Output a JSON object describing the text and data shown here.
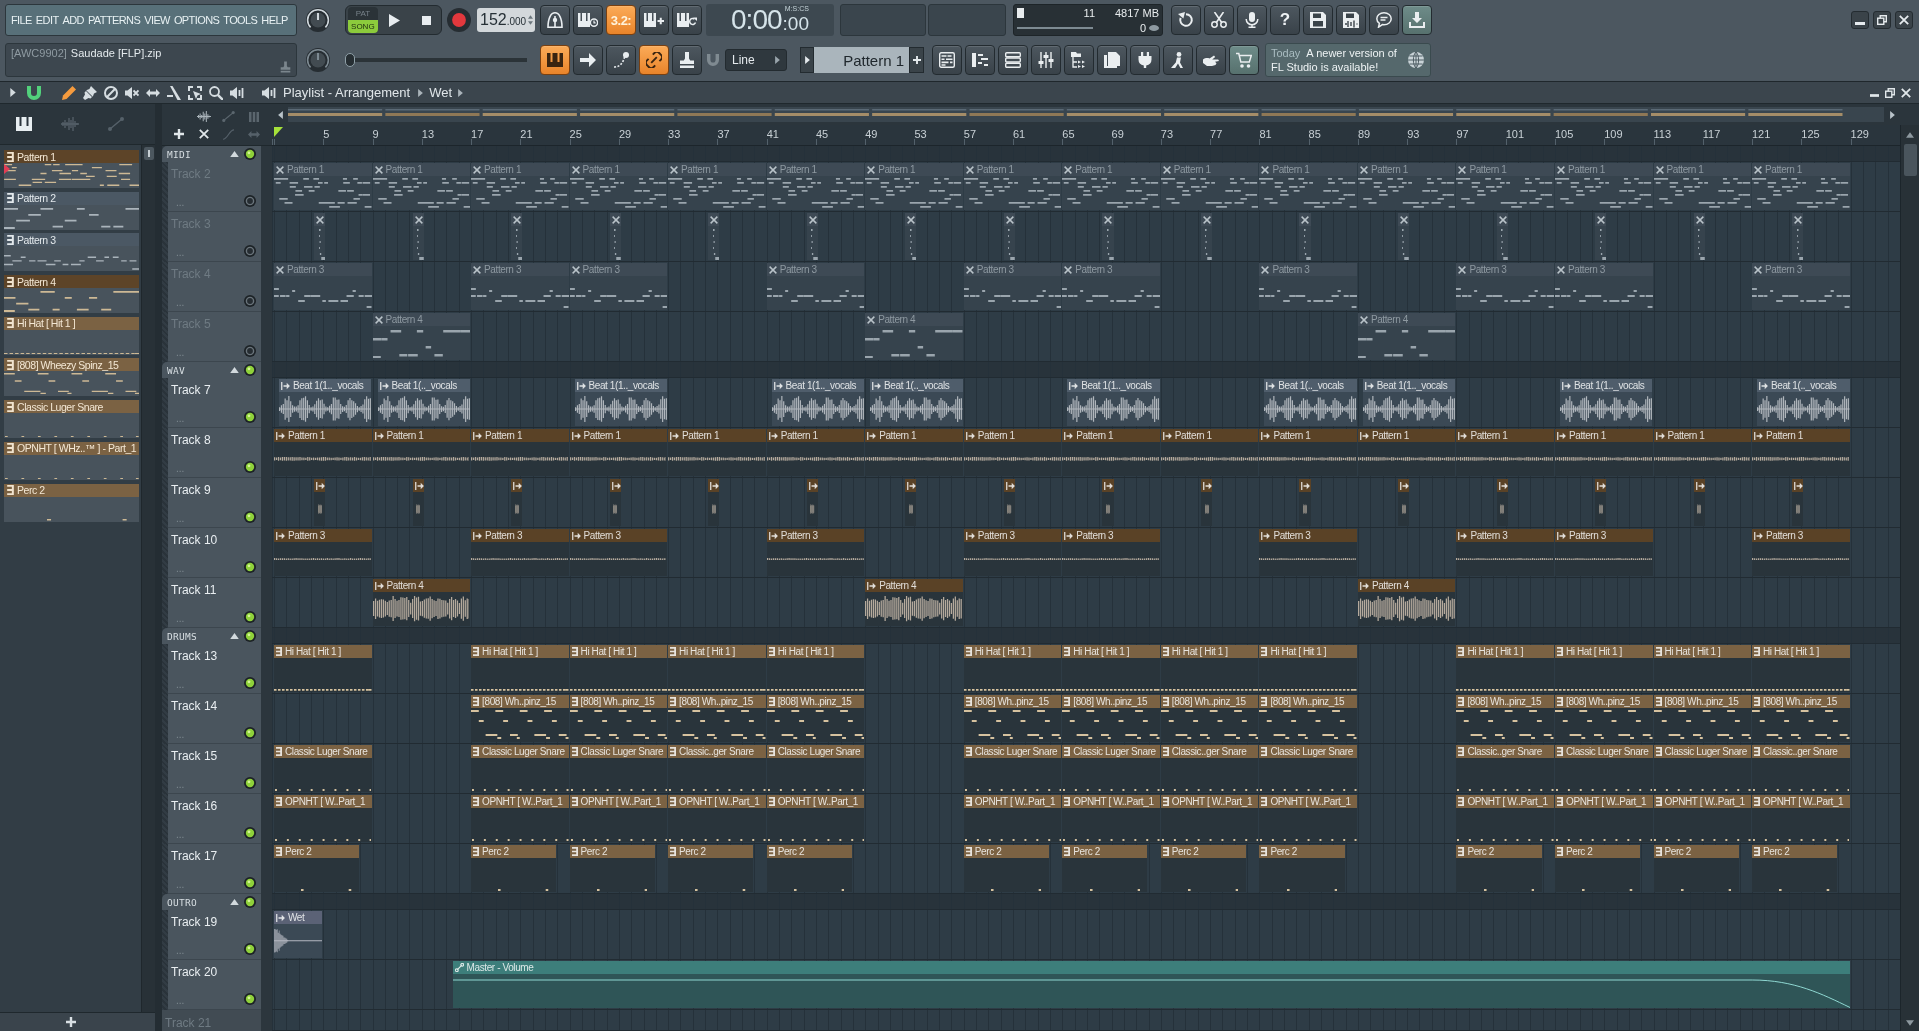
{
  "toolbar": {
    "menu": [
      "FILE",
      "EDIT",
      "ADD",
      "PATTERNS",
      "VIEW",
      "OPTIONS",
      "TOOLS",
      "HELP"
    ],
    "transport": {
      "modes": [
        {
          "label": "PAT",
          "selected": false
        },
        {
          "label": "SONG",
          "selected": true
        }
      ],
      "tempo": "152",
      "tempo_decimals": ".000"
    },
    "record_buttons": [
      {
        "on": false
      },
      {
        "on": false
      },
      {
        "label": "3.2:",
        "on": true
      },
      {
        "on": false
      },
      {
        "on": false
      }
    ],
    "time": {
      "value": "0:00",
      "fraction": ":00",
      "unit": "M:S:CS"
    },
    "monitor": {
      "cpu": "11",
      "memory": "4817 MB",
      "voices": "0"
    },
    "shortcut_buttons": [
      {
        "highlighted": false
      },
      {
        "highlighted": false
      },
      {
        "highlighted": false
      },
      {
        "label": "?",
        "highlighted": false
      },
      {
        "highlighted": false
      },
      {
        "highlighted": false
      },
      {
        "highlighted": false
      },
      {
        "highlighted": true
      }
    ],
    "hint": {
      "tag": "[AWC9902]",
      "text": "Saudade [FLP].zip"
    },
    "pitch_slider": {
      "level": 0
    },
    "snap_buttons": [
      {
        "on": true
      },
      {
        "on": false
      },
      {
        "on": false
      },
      {
        "on": true
      },
      {
        "on": false
      }
    ],
    "snap": {
      "value": "Line"
    },
    "pattern_selector": {
      "value": "Pattern 1"
    },
    "view_buttons": [
      {
        "highlighted": false
      },
      {
        "highlighted": false
      },
      {
        "highlighted": false
      },
      {
        "highlighted": false
      },
      {
        "highlighted": false
      },
      {
        "highlighted": false
      },
      {
        "highlighted": false
      },
      {
        "highlighted": false
      },
      {
        "highlighted": false
      },
      {
        "highlighted": true
      }
    ],
    "news": {
      "when": "Today",
      "text": "A newer version of FL Studio is available!"
    }
  },
  "playlist": {
    "title": "Playlist - Arrangement",
    "crumb": "Wet",
    "snap_on": true,
    "tools": [
      {
        "selected": true
      },
      {
        "selected": false
      },
      {
        "selected": false
      },
      {
        "selected": false
      },
      {
        "selected": false
      },
      {
        "selected": false
      },
      {
        "selected": false
      },
      {
        "selected": false
      },
      {
        "selected": false
      }
    ],
    "picker": {
      "tabs": [
        {
          "selected": true
        },
        {
          "selected": false
        },
        {
          "selected": false
        }
      ],
      "patterns": [
        {
          "label": "Pattern 1",
          "color": "#5d4428",
          "selected": true
        },
        {
          "label": "Pattern 2",
          "color": "#4b5864",
          "selected": false
        },
        {
          "label": "Pattern 3",
          "color": "#4b5864",
          "selected": false
        },
        {
          "label": "Pattern 4",
          "color": "#5d4428",
          "selected": false
        },
        {
          "label": "Hi Hat [ Hit 1 ]",
          "color": "#7b6243",
          "selected": false
        },
        {
          "label": "[808] Wheezy Spinz_15",
          "color": "#7b6243",
          "selected": false
        },
        {
          "label": "Classic Luger Snare",
          "color": "#7b6243",
          "selected": false
        },
        {
          "label": "OPNHT [ WHz..™ ] - Part_1",
          "color": "#7b6243",
          "selected": false
        },
        {
          "label": "Perc 2",
          "color": "#7b6243",
          "selected": false
        }
      ]
    },
    "ruler": [
      "5",
      "9",
      "13",
      "17",
      "21",
      "25",
      "29",
      "33",
      "37",
      "41",
      "45",
      "49",
      "53",
      "57",
      "61",
      "65",
      "69",
      "73",
      "77",
      "81",
      "85",
      "89",
      "93",
      "97",
      "101",
      "105",
      "109",
      "113",
      "117",
      "121",
      "125",
      "129"
    ],
    "groups": [
      {
        "name": "MIDI",
        "expanded": true,
        "on": true,
        "tracks": [
          {
            "name": "Track 2",
            "more": "...",
            "on": false,
            "color": "#3e4a55",
            "kind": "pattern",
            "clips": [
              {
                "label": "Pattern 1",
                "muted": true
              },
              {
                "label": "Pattern 1",
                "muted": true
              },
              {
                "label": "Pattern 1",
                "muted": true
              },
              {
                "label": "Pattern 1",
                "muted": true
              },
              {
                "label": "Pattern 1",
                "muted": true
              },
              {
                "label": "Pattern 1",
                "muted": true
              },
              {
                "label": "Pattern 1",
                "muted": true
              },
              {
                "label": "Pattern 1",
                "muted": true
              },
              {
                "label": "Pattern 1",
                "muted": true
              },
              {
                "label": "Pattern 1",
                "muted": true
              },
              {
                "label": "Pattern 1",
                "muted": true
              },
              {
                "label": "Pattern 1",
                "muted": true
              },
              {
                "label": "Pattern 1",
                "muted": true
              },
              {
                "label": "Pattern 1",
                "muted": true
              },
              {
                "label": "Pattern 1",
                "muted": true
              },
              {
                "label": "Pattern 1",
                "muted": true
              }
            ]
          },
          {
            "name": "Track 3",
            "more": "...",
            "on": false,
            "color": "#3e4a55",
            "kind": "pattern",
            "clips": [
              {
                "muted": true
              },
              {
                "muted": true
              },
              {
                "muted": true
              },
              {
                "muted": true
              },
              {
                "muted": true
              },
              {
                "muted": true
              },
              {
                "muted": true
              },
              {
                "muted": true
              },
              {
                "muted": true
              },
              {
                "muted": true
              },
              {
                "muted": true
              },
              {
                "muted": true
              },
              {
                "muted": true
              },
              {
                "muted": true
              },
              {
                "muted": true
              },
              {
                "muted": true
              }
            ]
          },
          {
            "name": "Track 4",
            "more": "...",
            "on": false,
            "color": "#3e4a55",
            "kind": "pattern",
            "clips": [
              {
                "label": "Pattern 3",
                "muted": true
              },
              {
                "label": "Pattern 3",
                "muted": true
              },
              {
                "label": "Pattern 3",
                "muted": true
              },
              {
                "label": "Pattern 3",
                "muted": true
              },
              {
                "label": "Pattern 3",
                "muted": true
              },
              {
                "label": "Pattern 3",
                "muted": true
              },
              {
                "label": "Pattern 3",
                "muted": true
              },
              {
                "label": "Pattern 3",
                "muted": true
              },
              {
                "label": "Pattern 3",
                "muted": true
              },
              {
                "label": "Pattern 3",
                "muted": true
              }
            ]
          },
          {
            "name": "Track 5",
            "more": "...",
            "on": false,
            "color": "#3e4a55",
            "kind": "pattern",
            "clips": [
              {
                "label": "Pattern 4",
                "muted": true
              },
              {
                "label": "Pattern 4",
                "muted": true
              },
              {
                "label": "Pattern 4",
                "muted": true
              }
            ]
          }
        ]
      },
      {
        "name": "WAV",
        "expanded": true,
        "on": true,
        "tracks": [
          {
            "name": "Track 7",
            "more": "...",
            "on": true,
            "color": "#4f5d6b",
            "kind": "audio",
            "clips": [
              {
                "label": "Beat 1(1.._vocals",
                "muted": false
              },
              {
                "label": "Beat 1(.._vocals",
                "muted": false
              },
              {
                "label": "Beat 1(1.._vocals",
                "muted": false
              },
              {
                "label": "Beat 1(1.._vocals",
                "muted": false
              },
              {
                "label": "Beat 1(.._vocals",
                "muted": false
              },
              {
                "label": "Beat 1(1.._vocals",
                "muted": false
              },
              {
                "label": "Beat 1(.._vocals",
                "muted": false
              },
              {
                "label": "Beat 1(1.._vocals",
                "muted": false
              },
              {
                "label": "Beat 1(1.._vocals",
                "muted": false
              },
              {
                "label": "Beat 1(.._vocals",
                "muted": false
              }
            ]
          },
          {
            "name": "Track 8",
            "more": "...",
            "on": true,
            "color": "#5a4226",
            "kind": "audio",
            "clips": [
              {
                "label": "Pattern 1",
                "muted": false
              },
              {
                "label": "Pattern 1",
                "muted": false
              },
              {
                "label": "Pattern 1",
                "muted": false
              },
              {
                "label": "Pattern 1",
                "muted": false
              },
              {
                "label": "Pattern 1",
                "muted": false
              },
              {
                "label": "Pattern 1",
                "muted": false
              },
              {
                "label": "Pattern 1",
                "muted": false
              },
              {
                "label": "Pattern 1",
                "muted": false
              },
              {
                "label": "Pattern 1",
                "muted": false
              },
              {
                "label": "Pattern 1",
                "muted": false
              },
              {
                "label": "Pattern 1",
                "muted": false
              },
              {
                "label": "Pattern 1",
                "muted": false
              },
              {
                "label": "Pattern 1",
                "muted": false
              },
              {
                "label": "Pattern 1",
                "muted": false
              },
              {
                "label": "Pattern 1",
                "muted": false
              },
              {
                "label": "Pattern 1",
                "muted": false
              }
            ]
          },
          {
            "name": "Track 9",
            "more": "...",
            "on": true,
            "color": "#5a4226",
            "kind": "audio",
            "clips": [
              {
                "muted": false
              },
              {
                "muted": false
              },
              {
                "muted": false
              },
              {
                "muted": false
              },
              {
                "muted": false
              },
              {
                "muted": false
              },
              {
                "muted": false
              },
              {
                "muted": false
              },
              {
                "muted": false
              },
              {
                "muted": false
              },
              {
                "muted": false
              },
              {
                "muted": false
              },
              {
                "muted": false
              },
              {
                "muted": false
              },
              {
                "muted": false
              },
              {
                "muted": false
              }
            ]
          },
          {
            "name": "Track 10",
            "more": "...",
            "on": true,
            "color": "#5a4226",
            "kind": "audio",
            "clips": [
              {
                "label": "Pattern 3",
                "muted": false
              },
              {
                "label": "Pattern 3",
                "muted": false
              },
              {
                "label": "Pattern 3",
                "muted": false
              },
              {
                "label": "Pattern 3",
                "muted": false
              },
              {
                "label": "Pattern 3",
                "muted": false
              },
              {
                "label": "Pattern 3",
                "muted": false
              },
              {
                "label": "Pattern 3",
                "muted": false
              },
              {
                "label": "Pattern 3",
                "muted": false
              },
              {
                "label": "Pattern 3",
                "muted": false
              },
              {
                "label": "Pattern 3",
                "muted": false
              }
            ]
          },
          {
            "name": "Track 11",
            "more": "...",
            "on": true,
            "color": "#5a4226",
            "kind": "audio",
            "clips": [
              {
                "label": "Pattern 4",
                "muted": false
              },
              {
                "label": "Pattern 4",
                "muted": false
              },
              {
                "label": "Pattern 4",
                "muted": false
              }
            ]
          }
        ]
      },
      {
        "name": "DRUMS",
        "expanded": true,
        "on": true,
        "tracks": [
          {
            "name": "Track 13",
            "more": "...",
            "on": true,
            "color": "#7b6243",
            "kind": "pattern",
            "clips": [
              {
                "label": "Hi Hat [ Hit 1 ]",
                "muted": false
              },
              {
                "label": "Hi Hat [ Hit 1 ]",
                "muted": false
              },
              {
                "label": "Hi Hat [ Hit 1 ]",
                "muted": false
              },
              {
                "label": "Hi Hat [ Hit 1 ]",
                "muted": false
              },
              {
                "label": "Hi Hat [ Hit 1 ]",
                "muted": false
              },
              {
                "label": "Hi Hat [ Hit 1 ]",
                "muted": false
              },
              {
                "label": "Hi Hat [ Hit 1 ]",
                "muted": false
              },
              {
                "label": "Hi Hat [ Hit 1 ]",
                "muted": false
              },
              {
                "label": "Hi Hat [ Hit 1 ]",
                "muted": false
              },
              {
                "label": "Hi Hat [ Hit 1 ]",
                "muted": false
              },
              {
                "label": "Hi Hat [ Hit 1 ]",
                "muted": false
              },
              {
                "label": "Hi Hat [ Hit 1 ]",
                "muted": false
              },
              {
                "label": "Hi Hat [ Hit 1 ]",
                "muted": false
              }
            ]
          },
          {
            "name": "Track 14",
            "more": "...",
            "on": true,
            "color": "#7b6243",
            "kind": "pattern",
            "clips": [
              {
                "label": "[808] Wh..pinz_15",
                "muted": false
              },
              {
                "label": "[808] Wh..pinz_15",
                "muted": false
              },
              {
                "label": "[808] Wh..pinz_15",
                "muted": false
              },
              {
                "label": "[808] Wh..pinz_15",
                "muted": false
              },
              {
                "label": "[808] Wh..pinz_15",
                "muted": false
              },
              {
                "label": "[808] Wh..pinz_15",
                "muted": false
              },
              {
                "label": "[808] Wh..pinz_15",
                "muted": false
              },
              {
                "label": "[808] Wh..pinz_15",
                "muted": false
              },
              {
                "label": "[808] Wh..pinz_15",
                "muted": false
              },
              {
                "label": "[808] Wh..pinz_15",
                "muted": false
              },
              {
                "label": "[808] Wh..pinz_15",
                "muted": false
              },
              {
                "label": "[808] Wh..pinz_15",
                "muted": false
              }
            ]
          },
          {
            "name": "Track 15",
            "more": "...",
            "on": true,
            "color": "#7b6243",
            "kind": "pattern",
            "clips": [
              {
                "label": "Classic Luger Snare",
                "muted": false
              },
              {
                "label": "Classic Luger Snare",
                "muted": false
              },
              {
                "label": "Classic Luger Snare",
                "muted": false
              },
              {
                "label": "Classic..ger Snare",
                "muted": false
              },
              {
                "label": "Classic Luger Snare",
                "muted": false
              },
              {
                "label": "Classic Luger Snare",
                "muted": false
              },
              {
                "label": "Classic Luger Snare",
                "muted": false
              },
              {
                "label": "Classic..ger Snare",
                "muted": false
              },
              {
                "label": "Classic Luger Snare",
                "muted": false
              },
              {
                "label": "Classic..ger Snare",
                "muted": false
              },
              {
                "label": "Classic Luger Snare",
                "muted": false
              },
              {
                "label": "Classic Luger Snare",
                "muted": false
              },
              {
                "label": "Classic..ger Snare",
                "muted": false
              }
            ]
          },
          {
            "name": "Track 16",
            "more": "...",
            "on": true,
            "color": "#7b6243",
            "kind": "pattern",
            "clips": [
              {
                "label": "OPNHT [ W..Part_1",
                "muted": false
              },
              {
                "label": "OPNHT [ W..Part_1",
                "muted": false
              },
              {
                "label": "OPNHT [ W..Part_1",
                "muted": false
              },
              {
                "label": "OPNHT [ W..Part_1",
                "muted": false
              },
              {
                "label": "OPNHT [ W..Part_1",
                "muted": false
              },
              {
                "label": "OPNHT [ W..Part_1",
                "muted": false
              },
              {
                "label": "OPNHT [ W..Part_1",
                "muted": false
              },
              {
                "label": "OPNHT [ W..Part_1",
                "muted": false
              },
              {
                "label": "OPNHT [ W..Part_1",
                "muted": false
              },
              {
                "label": "OPNHT [ W..Part_1",
                "muted": false
              },
              {
                "label": "OPNHT [ W..Part_1",
                "muted": false
              },
              {
                "label": "OPNHT [ W..Part_1",
                "muted": false
              },
              {
                "label": "OPNHT [ W..Part_1",
                "muted": false
              }
            ]
          },
          {
            "name": "Track 17",
            "more": "...",
            "on": true,
            "color": "#7b6243",
            "kind": "pattern",
            "clips": [
              {
                "label": "Perc 2",
                "muted": false
              },
              {
                "label": "Perc 2",
                "muted": false
              },
              {
                "label": "Perc 2",
                "muted": false
              },
              {
                "label": "Perc 2",
                "muted": false
              },
              {
                "label": "Perc 2",
                "muted": false
              },
              {
                "label": "Perc 2",
                "muted": false
              },
              {
                "label": "Perc 2",
                "muted": false
              },
              {
                "label": "Perc 2",
                "muted": false
              },
              {
                "label": "Perc 2",
                "muted": false
              },
              {
                "label": "Perc 2",
                "muted": false
              },
              {
                "label": "Perc 2",
                "muted": false
              },
              {
                "label": "Perc 2",
                "muted": false
              },
              {
                "label": "Perc 2",
                "muted": false
              }
            ]
          }
        ]
      },
      {
        "name": "OUTRO",
        "expanded": true,
        "on": true,
        "tracks": [
          {
            "name": "Track 19",
            "more": "...",
            "on": true,
            "color": "#5b6276",
            "kind": "audio",
            "clips": [
              {
                "label": "Wet",
                "muted": false
              }
            ]
          },
          {
            "name": "Track 20",
            "more": "...",
            "on": true,
            "color": "#3d7e7b",
            "kind": "automation",
            "clips": [
              {
                "label": "Master - Volume",
                "muted": false
              }
            ]
          }
        ]
      }
    ],
    "tracks": [
      {
        "name": "Track 21"
      }
    ]
  }
}
